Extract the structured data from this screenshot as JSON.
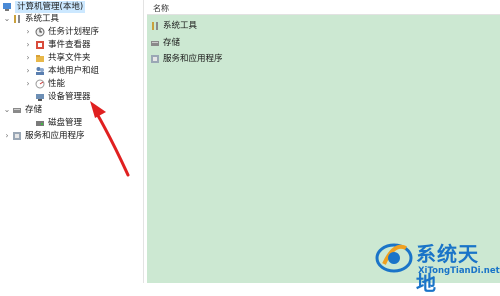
{
  "tree": {
    "root": "计算机管理(本地)",
    "system_tools": "系统工具",
    "task_scheduler": "任务计划程序",
    "event_viewer": "事件查看器",
    "shared_folders": "共享文件夹",
    "local_users": "本地用户和组",
    "performance": "性能",
    "device_manager": "设备管理器",
    "storage": "存储",
    "disk_management": "磁盘管理",
    "services_apps": "服务和应用程序"
  },
  "content": {
    "column_name": "名称",
    "items": [
      "系统工具",
      "存储",
      "服务和应用程序"
    ]
  },
  "watermark": {
    "title": "系统天地",
    "url": "XiTongTianDi.net"
  },
  "colors": {
    "content_background": "#cce8d2",
    "arrow": "#e02020",
    "watermark": "#1a74c8"
  }
}
